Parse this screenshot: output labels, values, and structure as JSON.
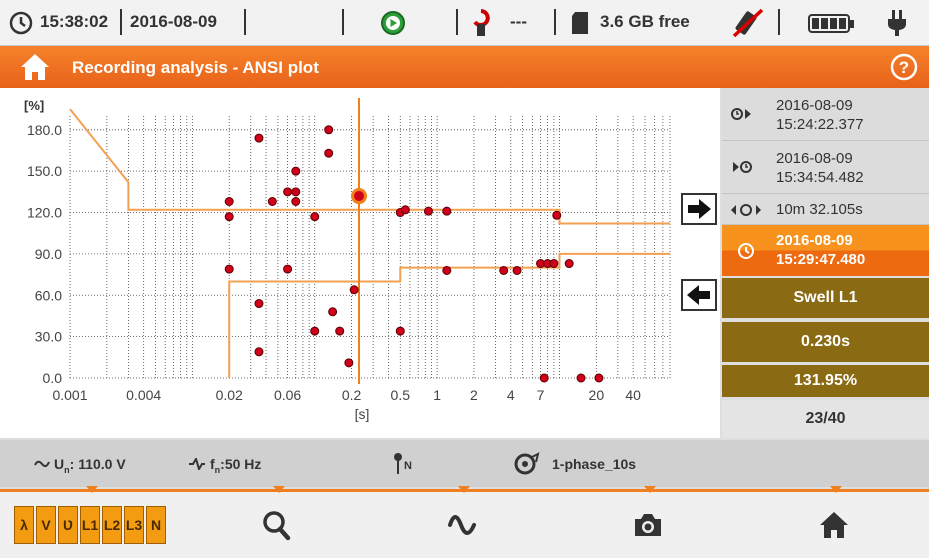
{
  "status": {
    "time": "15:38:02",
    "date": "2016-08-09",
    "clamp_value": "---",
    "storage": "3.6 GB free"
  },
  "header": {
    "title": "Recording analysis - ANSI plot"
  },
  "plot": {
    "y_unit": "[%]",
    "x_unit": "[s]",
    "y_ticks": [
      "0.0",
      "30.0",
      "60.0",
      "90.0",
      "120.0",
      "150.0",
      "180.0"
    ],
    "x_ticks": [
      "0.001",
      "0.004",
      "0.02",
      "0.06",
      "0.2",
      "0.5",
      "1",
      "2",
      "4",
      "7",
      "20",
      "40"
    ]
  },
  "chart_data": {
    "type": "scatter",
    "title": "",
    "xlabel": "[s]",
    "ylabel": "[%]",
    "x_scale": "log",
    "xlim": [
      0.001,
      80
    ],
    "ylim": [
      0,
      190
    ],
    "grid": true,
    "upper_limit": [
      [
        0.001,
        195
      ],
      [
        0.003,
        142
      ],
      [
        0.003,
        122
      ],
      [
        10,
        122
      ],
      [
        10,
        112
      ],
      [
        80,
        112
      ]
    ],
    "lower_limit": [
      [
        0.02,
        0
      ],
      [
        0.02,
        70
      ],
      [
        0.5,
        70
      ],
      [
        0.5,
        80
      ],
      [
        10,
        80
      ],
      [
        10,
        90
      ],
      [
        80,
        90
      ]
    ],
    "cursor_x": 0.23,
    "selected_point": {
      "x": 0.23,
      "y": 131.95
    },
    "points": [
      {
        "x": 0.02,
        "y": 128
      },
      {
        "x": 0.02,
        "y": 117
      },
      {
        "x": 0.02,
        "y": 79
      },
      {
        "x": 0.035,
        "y": 174
      },
      {
        "x": 0.035,
        "y": 54
      },
      {
        "x": 0.035,
        "y": 19
      },
      {
        "x": 0.045,
        "y": 128
      },
      {
        "x": 0.06,
        "y": 135
      },
      {
        "x": 0.06,
        "y": 79
      },
      {
        "x": 0.07,
        "y": 150
      },
      {
        "x": 0.07,
        "y": 135
      },
      {
        "x": 0.07,
        "y": 128
      },
      {
        "x": 0.1,
        "y": 117
      },
      {
        "x": 0.1,
        "y": 34
      },
      {
        "x": 0.13,
        "y": 180
      },
      {
        "x": 0.13,
        "y": 163
      },
      {
        "x": 0.14,
        "y": 48
      },
      {
        "x": 0.16,
        "y": 34
      },
      {
        "x": 0.19,
        "y": 11
      },
      {
        "x": 0.21,
        "y": 64
      },
      {
        "x": 0.5,
        "y": 120
      },
      {
        "x": 0.55,
        "y": 122
      },
      {
        "x": 0.5,
        "y": 34
      },
      {
        "x": 0.85,
        "y": 121
      },
      {
        "x": 1.2,
        "y": 121
      },
      {
        "x": 1.2,
        "y": 78
      },
      {
        "x": 3.5,
        "y": 78
      },
      {
        "x": 4.5,
        "y": 78
      },
      {
        "x": 7,
        "y": 83
      },
      {
        "x": 8,
        "y": 83
      },
      {
        "x": 9.5,
        "y": 118
      },
      {
        "x": 9,
        "y": 83
      },
      {
        "x": 12,
        "y": 83
      },
      {
        "x": 7.5,
        "y": 0
      },
      {
        "x": 15,
        "y": 0
      },
      {
        "x": 21,
        "y": 0
      }
    ]
  },
  "panel": {
    "start_date": "2016-08-09",
    "start_time": "15:24:22.377",
    "end_date": "2016-08-09",
    "end_time": "15:34:54.482",
    "duration": "10m 32.105s",
    "cursor_date": "2016-08-09",
    "cursor_time": "15:29:47.480",
    "event_type": "Swell L1",
    "event_duration": "0.230s",
    "event_value": "131.95%",
    "event_index": "23/40"
  },
  "info": {
    "voltage": "110.0 V",
    "voltage_label": "U",
    "voltage_sub": "n",
    "freq": ":50 Hz",
    "freq_label": "f",
    "freq_sub": "n",
    "neutral": "N",
    "config": "1-phase_10s"
  },
  "nav": {
    "phases": [
      "L1",
      "L2",
      "L3",
      "N"
    ]
  },
  "colors": {
    "accent": "#f0801f",
    "brown": "#8a6a12",
    "limit_line": "#f2a150",
    "point": "#d0001a"
  }
}
